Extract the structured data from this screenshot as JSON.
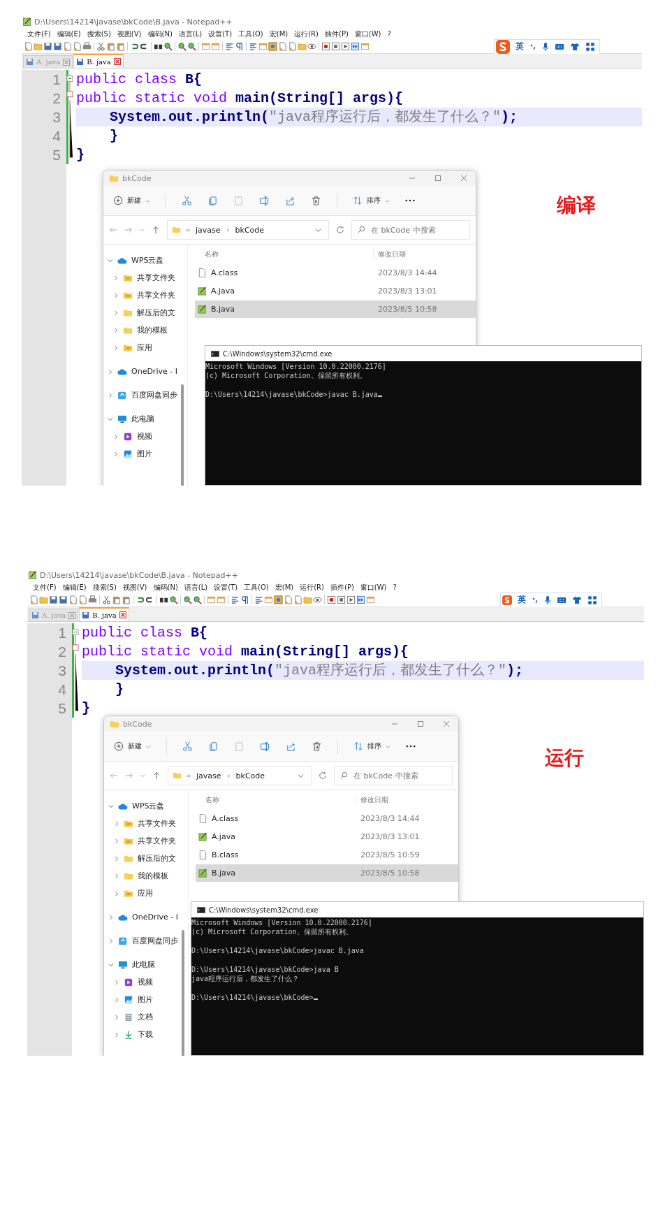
{
  "screens": [
    {
      "notepad": {
        "title": "D:\\Users\\14214\\javase\\bkCode\\B.java - Notepad++",
        "menu": [
          "文件(F)",
          "编辑(E)",
          "搜索(S)",
          "视图(V)",
          "编码(N)",
          "语言(L)",
          "设置(T)",
          "工具(O)",
          "宏(M)",
          "运行(R)",
          "插件(P)",
          "窗口(W)",
          "?"
        ],
        "ime_language": "英",
        "tabs": [
          {
            "label": "A. java",
            "selected": false
          },
          {
            "label": "B. java",
            "selected": true
          }
        ],
        "lines": [
          {
            "number": "1",
            "current": false,
            "tokens": [
              {
                "text": "public class ",
                "kind": "keyword"
              },
              {
                "text": "B{",
                "kind": "name"
              }
            ]
          },
          {
            "number": "2",
            "current": false,
            "tokens": [
              {
                "text": "public static void ",
                "kind": "keyword"
              },
              {
                "text": "main(String[] args){",
                "kind": "name"
              }
            ]
          },
          {
            "number": "3",
            "current": true,
            "tokens": [
              {
                "text": "    System.out.println(",
                "kind": "name"
              },
              {
                "text": "\"java程序运行后，都发生了什么？\"",
                "kind": "string"
              },
              {
                "text": ");",
                "kind": "name"
              }
            ]
          },
          {
            "number": "4",
            "current": false,
            "tokens": [
              {
                "text": "    }",
                "kind": "name"
              }
            ]
          },
          {
            "number": "5",
            "current": false,
            "tokens": [
              {
                "text": "}",
                "kind": "name"
              }
            ]
          }
        ]
      },
      "explorer": {
        "title": "bkCode",
        "new_label": "新建",
        "sort_label": "排序",
        "path": [
          "javase",
          "bkCode"
        ],
        "search": {
          "placeholder": "在 bkCode 中搜索"
        },
        "columns": [
          "名称",
          "修改日期"
        ],
        "tree": [
          {
            "label": "WPS云盘",
            "kind": "cloud",
            "expanded": true,
            "children": [
              {
                "label": "共享文件夹",
                "kind": "shared",
                "expanded": false
              },
              {
                "label": "共享文件夹",
                "kind": "shared",
                "expanded": false
              },
              {
                "label": "解压后的文",
                "kind": "folder",
                "expanded": false
              },
              {
                "label": "我的模板",
                "kind": "folder",
                "expanded": false
              },
              {
                "label": "应用",
                "kind": "shared",
                "expanded": false
              }
            ]
          },
          {
            "label": "OneDrive - I",
            "kind": "cloud",
            "expanded": false
          },
          {
            "label": "百度网盘同步",
            "kind": "sync",
            "expanded": false
          },
          {
            "label": "此电脑",
            "kind": "computer",
            "expanded": true,
            "children": [
              {
                "label": "视频",
                "kind": "video",
                "expanded": false
              },
              {
                "label": "图片",
                "kind": "image",
                "expanded": false
              }
            ]
          }
        ],
        "files": [
          {
            "name": "A.class",
            "date": "2023/8/3 14:44",
            "kind": "class",
            "selected": false
          },
          {
            "name": "A.java",
            "date": "2023/8/3 13:01",
            "kind": "java",
            "selected": false
          },
          {
            "name": "B.java",
            "date": "2023/8/5 10:58",
            "kind": "java",
            "selected": true
          }
        ]
      },
      "cmd": {
        "title": "C:\\Windows\\system32\\cmd.exe",
        "blocks": [
          [
            "Microsoft Windows [Version 10.0.22000.2176]",
            "(c) Microsoft Corporation。保留所有权利。"
          ],
          [
            "D:\\Users\\14214\\javase\\bkCode>javac B.java"
          ]
        ]
      },
      "caption": "编译"
    },
    {
      "notepad": {
        "title": "D:\\Users\\14214\\javase\\bkCode\\B.java - Notepad++",
        "menu": [
          "文件(F)",
          "编辑(E)",
          "搜索(S)",
          "视图(V)",
          "编码(N)",
          "语言(L)",
          "设置(T)",
          "工具(O)",
          "宏(M)",
          "运行(R)",
          "插件(P)",
          "窗口(W)",
          "?"
        ],
        "ime_language": "英",
        "tabs": [
          {
            "label": "A. java",
            "selected": false
          },
          {
            "label": "B. java",
            "selected": true
          }
        ],
        "lines": [
          {
            "number": "1",
            "current": false,
            "tokens": [
              {
                "text": "public class ",
                "kind": "keyword"
              },
              {
                "text": "B{",
                "kind": "name"
              }
            ]
          },
          {
            "number": "2",
            "current": false,
            "tokens": [
              {
                "text": "public static void ",
                "kind": "keyword"
              },
              {
                "text": "main(String[] args){",
                "kind": "name"
              }
            ]
          },
          {
            "number": "3",
            "current": true,
            "tokens": [
              {
                "text": "    System.out.println(",
                "kind": "name"
              },
              {
                "text": "\"java程序运行后，都发生了什么？\"",
                "kind": "string"
              },
              {
                "text": ");",
                "kind": "name"
              }
            ]
          },
          {
            "number": "4",
            "current": false,
            "tokens": [
              {
                "text": "    }",
                "kind": "name"
              }
            ]
          },
          {
            "number": "5",
            "current": false,
            "tokens": [
              {
                "text": "}",
                "kind": "name"
              }
            ]
          }
        ]
      },
      "explorer": {
        "title": "bkCode",
        "new_label": "新建",
        "sort_label": "排序",
        "path": [
          "javase",
          "bkCode"
        ],
        "search": {
          "placeholder": "在 bkCode 中搜索"
        },
        "columns": [
          "名称",
          "修改日期"
        ],
        "tree": [
          {
            "label": "WPS云盘",
            "kind": "cloud",
            "expanded": true,
            "children": [
              {
                "label": "共享文件夹",
                "kind": "shared",
                "expanded": false
              },
              {
                "label": "共享文件夹",
                "kind": "shared",
                "expanded": false
              },
              {
                "label": "解压后的文",
                "kind": "folder",
                "expanded": false
              },
              {
                "label": "我的模板",
                "kind": "folder",
                "expanded": false
              },
              {
                "label": "应用",
                "kind": "shared",
                "expanded": false
              }
            ]
          },
          {
            "label": "OneDrive - I",
            "kind": "cloud",
            "expanded": false
          },
          {
            "label": "百度网盘同步",
            "kind": "sync",
            "expanded": false
          },
          {
            "label": "此电脑",
            "kind": "computer",
            "expanded": true,
            "children": [
              {
                "label": "视频",
                "kind": "video",
                "expanded": false
              },
              {
                "label": "图片",
                "kind": "image",
                "expanded": false
              },
              {
                "label": "文档",
                "kind": "doc",
                "expanded": false
              },
              {
                "label": "下载",
                "kind": "download",
                "expanded": false
              }
            ]
          }
        ],
        "files": [
          {
            "name": "A.class",
            "date": "2023/8/3 14:44",
            "kind": "class",
            "selected": false
          },
          {
            "name": "A.java",
            "date": "2023/8/3 13:01",
            "kind": "java",
            "selected": false
          },
          {
            "name": "B.class",
            "date": "2023/8/5 10:59",
            "kind": "class",
            "selected": false
          },
          {
            "name": "B.java",
            "date": "2023/8/5 10:58",
            "kind": "java",
            "selected": true
          }
        ]
      },
      "cmd": {
        "title": "C:\\Windows\\system32\\cmd.exe",
        "blocks": [
          [
            "Microsoft Windows [Version 10.0.22000.2176]",
            "(c) Microsoft Corporation。保留所有权利。"
          ],
          [
            "D:\\Users\\14214\\javase\\bkCode>javac B.java"
          ],
          [
            "D:\\Users\\14214\\javase\\bkCode>java B",
            "java程序运行后，都发生了什么？"
          ],
          [
            "D:\\Users\\14214\\javase\\bkCode>"
          ]
        ]
      },
      "caption": "运行"
    }
  ]
}
